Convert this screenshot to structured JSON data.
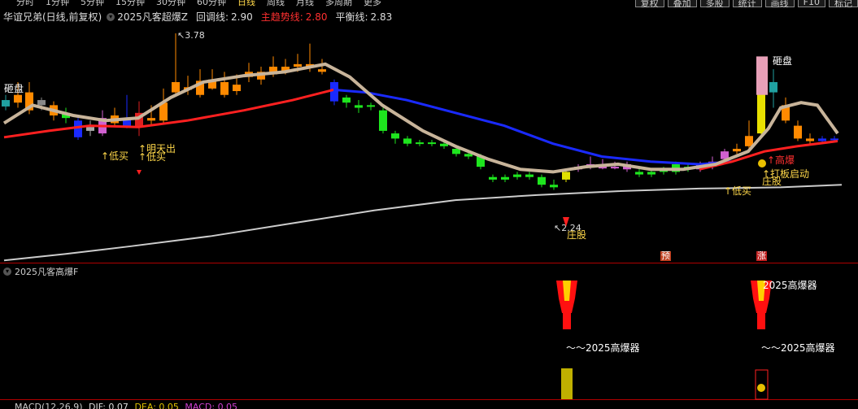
{
  "top_tabs": [
    "分时",
    "1分钟",
    "5分钟",
    "15分钟",
    "30分钟",
    "60分钟",
    "日线",
    "周线",
    "月线",
    "多周期",
    "更多"
  ],
  "active_tab": "日线",
  "right_buttons": [
    "复权",
    "叠加",
    "多股",
    "统计",
    "画线",
    "F10",
    "标记"
  ],
  "main_legend": {
    "stock": "华谊兄弟(日线,前复权)",
    "indicator": "2025凡客超爆Z",
    "pullback_label": "回调线:",
    "pullback_value": "2.90",
    "main_trend_label": "主趋势线:",
    "main_trend_value": "2.80",
    "balance_label": "平衡线:",
    "balance_value": "2.83"
  },
  "annotations": {
    "high_price": "3.78",
    "low_price": "2.24",
    "smash_left": "砸盘",
    "smash_right": "砸盘",
    "low_buy_1": "↑低买",
    "low_buy_2": "↑低买",
    "low_buy_3": "↑低买",
    "tomorrow_out": "明天出",
    "accumulate_1": "庄股",
    "high_burst": "高爆",
    "limit_start": "打板启动",
    "accumulate_2": "庄股",
    "pre_tag": "预",
    "rise_tag": "涨"
  },
  "sub_legend": "2025凡客高爆F",
  "sub_labels": [
    "～～2025高爆器",
    "2025高爆器",
    "～～2025高爆器"
  ],
  "macd_legend": {
    "name": "MACD(12,26,9)",
    "dif": "DIF: 0.07",
    "dea": "DEA: 0.05",
    "macd": "MACD: 0.05"
  },
  "colors": {
    "up": "#ff8a00",
    "down": "#1ee61e",
    "pullback": "#c8b49a",
    "trend": "#ff2020",
    "balance": "#cccccc",
    "blue_line": "#1a2aff"
  },
  "chart_data": {
    "type": "candlestick",
    "high": 3.78,
    "low": 2.24,
    "series": [
      {
        "name": "回调线",
        "last": 2.9
      },
      {
        "name": "主趋势线",
        "last": 2.8
      },
      {
        "name": "平衡线",
        "last": 2.83
      }
    ]
  }
}
